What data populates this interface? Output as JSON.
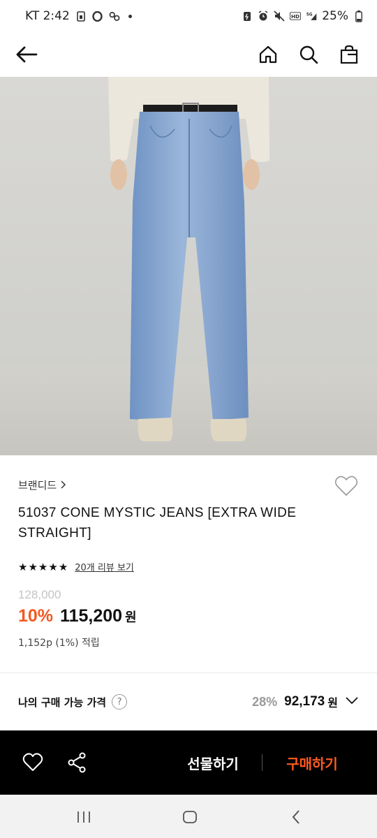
{
  "status_bar": {
    "carrier_time": "KT 2:42",
    "battery": "25%"
  },
  "app_bar": {
    "icons": [
      "back-arrow-icon",
      "home-icon",
      "search-icon",
      "shopping-bag-icon"
    ]
  },
  "product": {
    "brand": "브랜디드",
    "title": "51037 CONE MYSTIC JEANS [EXTRA WIDE STRAIGHT]",
    "rating_stars": 5,
    "review_link": "20개 리뷰 보기",
    "original_price": "128,000",
    "discount": "10%",
    "sale_price": "115,200",
    "currency": "원",
    "points": "1,152p (1%) 적립"
  },
  "my_price": {
    "label": "나의 구매 가능 가격",
    "help": "?",
    "rate": "28%",
    "amount": "92,173",
    "currency": "원"
  },
  "action_bar": {
    "gift_label": "선물하기",
    "buy_label": "구매하기",
    "accent_color": "#ff5a1f"
  },
  "colors": {
    "discount": "#f15a22",
    "action_bar_bg": "#000000"
  }
}
